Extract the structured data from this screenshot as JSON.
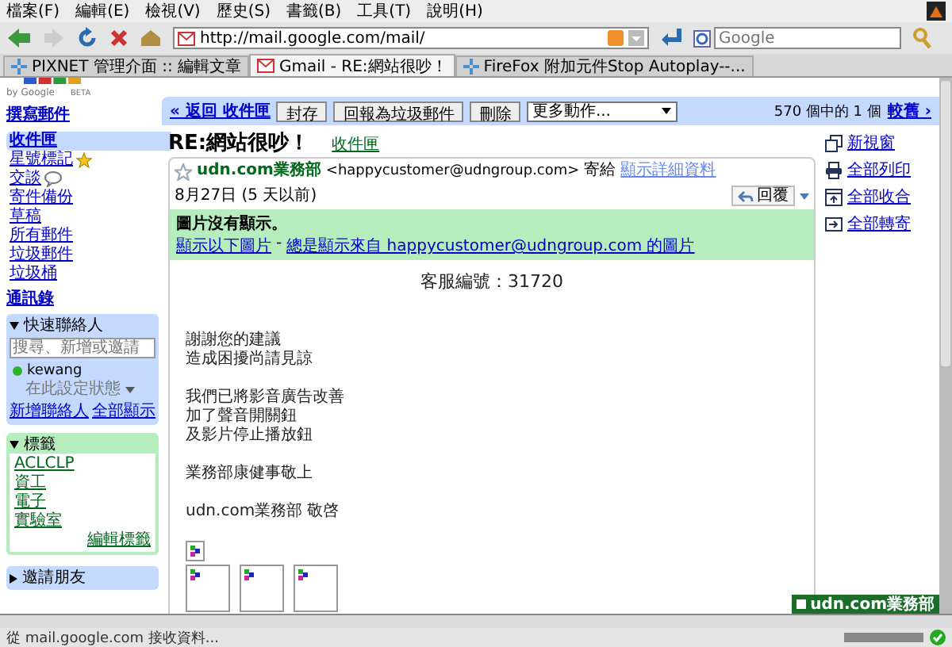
{
  "menu": [
    "檔案(F)",
    "編輯(E)",
    "檢視(V)",
    "歷史(S)",
    "書籤(B)",
    "工具(T)",
    "說明(H)"
  ],
  "toolbar": {
    "url": "http://mail.google.com/mail/",
    "search_placeholder": "Google"
  },
  "tabs": [
    {
      "label": "PIXNET 管理介面 :: 編輯文章",
      "selected": false,
      "kind": "generic"
    },
    {
      "label": "Gmail - RE:網站很吵！",
      "selected": true,
      "kind": "gmail"
    },
    {
      "label": "FireFox 附加元件Stop Autoplay--...",
      "selected": false,
      "kind": "generic"
    }
  ],
  "logo": {
    "sub": "by Google",
    "badge": "BETA"
  },
  "sidebar": {
    "compose": "撰寫郵件",
    "folders": [
      {
        "label": "收件匣",
        "selected": true,
        "kind": "plain"
      },
      {
        "label": "星號標記",
        "selected": false,
        "kind": "star"
      },
      {
        "label": "交談",
        "selected": false,
        "kind": "chat"
      },
      {
        "label": "寄件備份",
        "selected": false,
        "kind": "plain"
      },
      {
        "label": "草稿",
        "selected": false,
        "kind": "plain"
      },
      {
        "label": "所有郵件",
        "selected": false,
        "kind": "plain"
      },
      {
        "label": "垃圾郵件",
        "selected": false,
        "kind": "plain"
      },
      {
        "label": "垃圾桶",
        "selected": false,
        "kind": "plain"
      }
    ],
    "contacts_link": "通訊錄",
    "contacts": {
      "title": "快速聯絡人",
      "expanded": true,
      "placeholder": "搜尋、新增或邀請",
      "name": "kewang",
      "online": true,
      "status": "在此設定狀態",
      "links": [
        "新增聯絡人",
        "全部顯示"
      ]
    },
    "labels": {
      "title": "標籤",
      "expanded": true,
      "items": [
        "ACLCLP",
        "資工",
        "電子",
        "實驗室"
      ],
      "edit": "編輯標籤"
    },
    "invite": {
      "title": "邀請朋友",
      "expanded": false
    }
  },
  "actions": {
    "back": "« 返回 收件匣",
    "buttons": [
      "封存",
      "回報為垃圾郵件",
      "刪除"
    ],
    "dropdown": "更多動作...",
    "count": "570 個中的 1 個",
    "older": "較舊 ›"
  },
  "subject": "RE:網站很吵！",
  "subject_label": "收件匣",
  "message": {
    "starred": false,
    "sender": "udn.com業務部",
    "email": "<happycustomer@udngroup.com>",
    "to": "寄給",
    "details": "顯示詳細資料",
    "date": "8月27日 (5 天以前)",
    "reply": "回覆",
    "notice": {
      "title": "圖片沒有顯示。",
      "show": "顯示以下圖片",
      "sep": "-",
      "always": "總是顯示來自 happycustomer@udngroup.com 的圖片"
    },
    "service_no": "客服編號：31720",
    "paragraphs": [
      [
        "謝謝您的建議",
        "造成困擾尚請見諒"
      ],
      [
        "我們已將影音廣告改善",
        "加了聲音開關鈕",
        "及影片停止播放鈕"
      ],
      [
        "業務部康健事敬上"
      ],
      [
        "udn.com業務部 敬啓"
      ]
    ]
  },
  "side_links": [
    {
      "kind": "new-window",
      "label": "新視窗"
    },
    {
      "kind": "print",
      "label": "全部列印"
    },
    {
      "kind": "collapse",
      "label": "全部收合"
    },
    {
      "kind": "forward",
      "label": "全部轉寄"
    }
  ],
  "chat_tab": "udn.com業務部",
  "status": "從 mail.google.com 接收資料...",
  "progress": {
    "level": 1
  }
}
